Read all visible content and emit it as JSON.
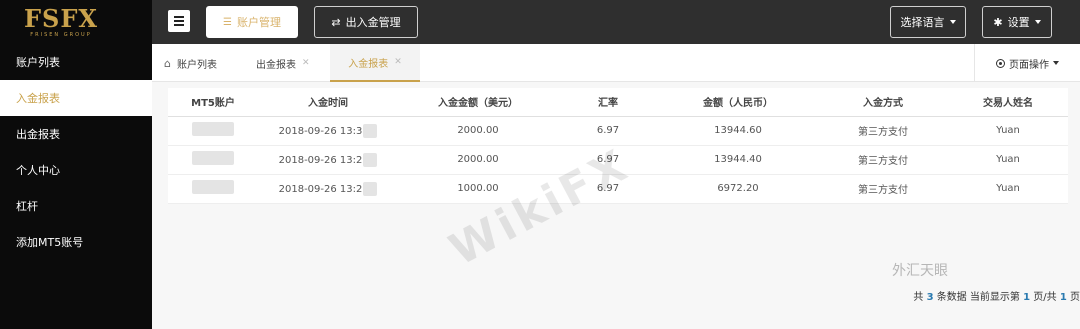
{
  "brand": {
    "logo": "FSFX",
    "tagline": "FRISEN GROUP"
  },
  "sidebar": {
    "items": [
      {
        "label": "账户列表"
      },
      {
        "label": "入金报表"
      },
      {
        "label": "出金报表"
      },
      {
        "label": "个人中心"
      },
      {
        "label": "杠杆"
      },
      {
        "label": "添加MT5账号"
      }
    ]
  },
  "topbar": {
    "account_mgmt": "账户管理",
    "money_mgmt": "出入金管理",
    "language": "选择语言",
    "settings": "设置"
  },
  "tabs": [
    {
      "label": "账户列表"
    },
    {
      "label": "出金报表"
    },
    {
      "label": "入金报表"
    }
  ],
  "page_ops": "页面操作",
  "table": {
    "headers": [
      "MT5账户",
      "入金时间",
      "入金金额（美元）",
      "汇率",
      "金额（人民币）",
      "入金方式",
      "交易人姓名"
    ],
    "rows": [
      {
        "account": "",
        "time": "2018-09-26 13:3",
        "usd": "2000.00",
        "rate": "6.97",
        "cny": "13944.60",
        "method": "第三方支付",
        "name": "Yuan"
      },
      {
        "account": "",
        "time": "2018-09-26 13:2",
        "usd": "2000.00",
        "rate": "6.97",
        "cny": "13944.40",
        "method": "第三方支付",
        "name": "Yuan"
      },
      {
        "account": "",
        "time": "2018-09-26 13:2",
        "usd": "1000.00",
        "rate": "6.97",
        "cny": "6972.20",
        "method": "第三方支付",
        "name": "Yuan"
      }
    ]
  },
  "pager": {
    "prefix": "共",
    "total": "3",
    "middle": "条数据 当前显示第",
    "current": "1",
    "slash": "页/共",
    "pages": "1",
    "suffix": "页"
  },
  "watermark": "WikiFX",
  "wechat_mark": "外汇天眼"
}
